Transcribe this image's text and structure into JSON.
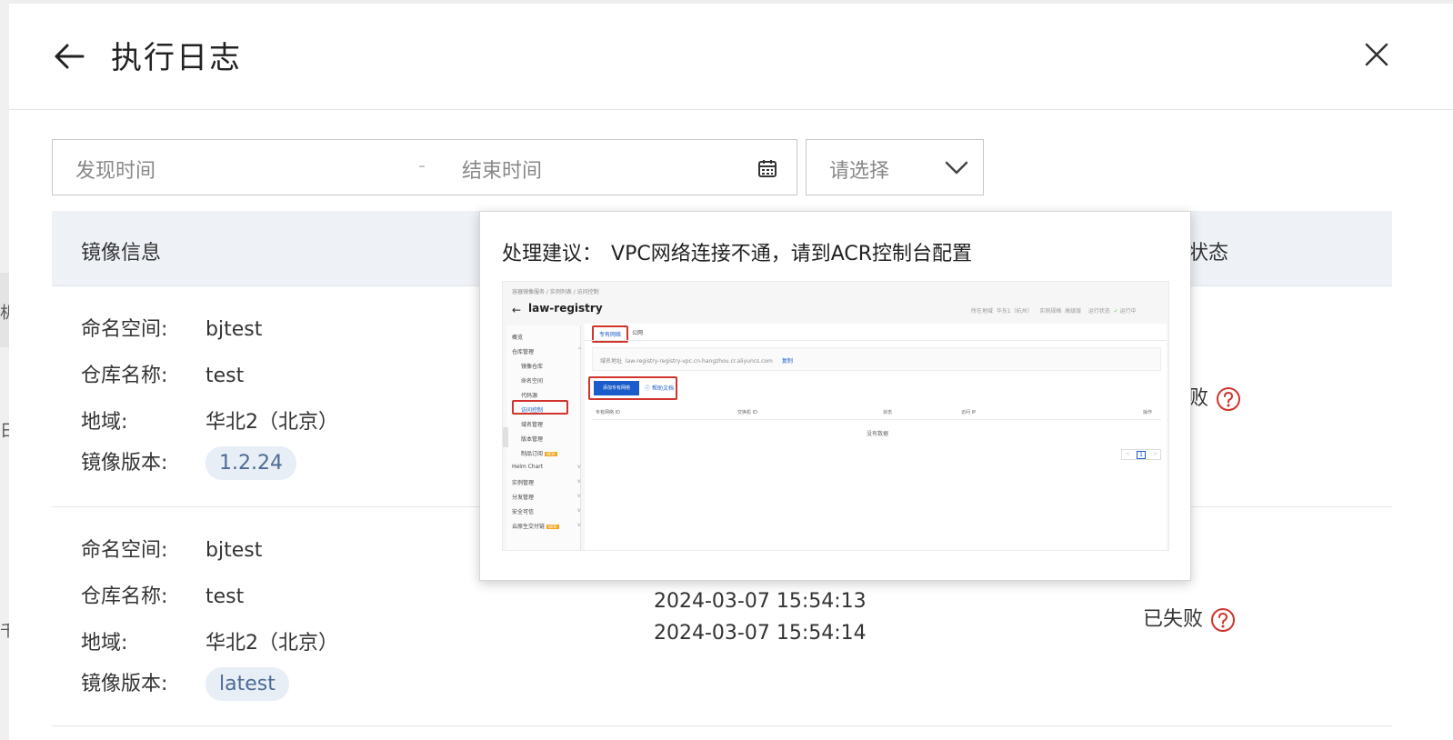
{
  "background": {
    "left_chars": [
      "机",
      "日",
      "千"
    ]
  },
  "header": {
    "title": "执行日志"
  },
  "filters": {
    "start_placeholder": "发现时间",
    "separator": "-",
    "end_placeholder": "结束时间",
    "select_placeholder": "请选择"
  },
  "table": {
    "col_image_info": "镜像信息",
    "col_status": "状态",
    "rows": [
      {
        "namespace_label": "命名空间:",
        "namespace": "bjtest",
        "repo_label": "仓库名称:",
        "repo": "test",
        "region_label": "地域:",
        "region": "华北2（北京）",
        "version_label": "镜像版本:",
        "version": "1.2.24",
        "status": "败"
      },
      {
        "namespace_label": "命名空间:",
        "namespace": "bjtest",
        "repo_label": "仓库名称:",
        "repo": "test",
        "region_label": "地域:",
        "region": "华北2（北京）",
        "version_label": "镜像版本:",
        "version": "latest",
        "time_start": "2024-03-07 15:54:13",
        "time_end": "2024-03-07 15:54:14",
        "status": "已失败"
      }
    ]
  },
  "popover": {
    "label": "处理建议：",
    "message": "VPC网络连接不通，请到ACR控制台配置",
    "screenshot": {
      "breadcrumb": "容器镜像服务 / 实例列表 / 访问控制",
      "instance_name": "law-registry",
      "meta_region_label": "所在地域",
      "meta_region": "华东1（杭州）",
      "meta_spec_label": "实例规格",
      "meta_spec": "高级版",
      "meta_status_label": "运行状态",
      "meta_status": "运行中",
      "sidebar": {
        "overview": "概览",
        "repo_mgmt": "仓库管理",
        "image_repo": "镜像仓库",
        "namespace": "命名空间",
        "code_source": "代码源",
        "access_control": "访问控制",
        "domain": "域名管理",
        "version_mgmt": "版本管理",
        "product_trace": "制品订阅",
        "new_badge": "NEW",
        "helm": "Helm Chart",
        "instance_mgmt": "实例管理",
        "dist_mgmt": "分发管理",
        "security": "安全可信",
        "cloud_native": "云原生交付链"
      },
      "tab_vpc": "专有网络",
      "tab_public": "公网",
      "domain_label": "域名地址",
      "domain_value": "law-registry-registry-vpc.cn-hangzhou.cr.aliyuncs.com",
      "copy": "复制",
      "add_button": "添加专有网络",
      "help_doc": "帮助文档",
      "col_vpc": "专有网络 ID",
      "col_switch": "交换机 ID",
      "col_status": "状态",
      "col_ip": "访问 IP",
      "col_ops": "操作",
      "no_data": "没有数据",
      "page": "1",
      "prev": "<",
      "next": ">"
    }
  },
  "colors": {
    "accent_blue": "#1a5cc9",
    "danger_red": "#d0342c",
    "tag_bg": "#e8eef6",
    "header_bg": "#eef1f6"
  },
  "icons": {
    "back": "arrow-left-icon",
    "close": "close-icon",
    "calendar": "calendar-icon",
    "dropdown": "chevron-down-icon",
    "help": "question-circle-icon"
  }
}
